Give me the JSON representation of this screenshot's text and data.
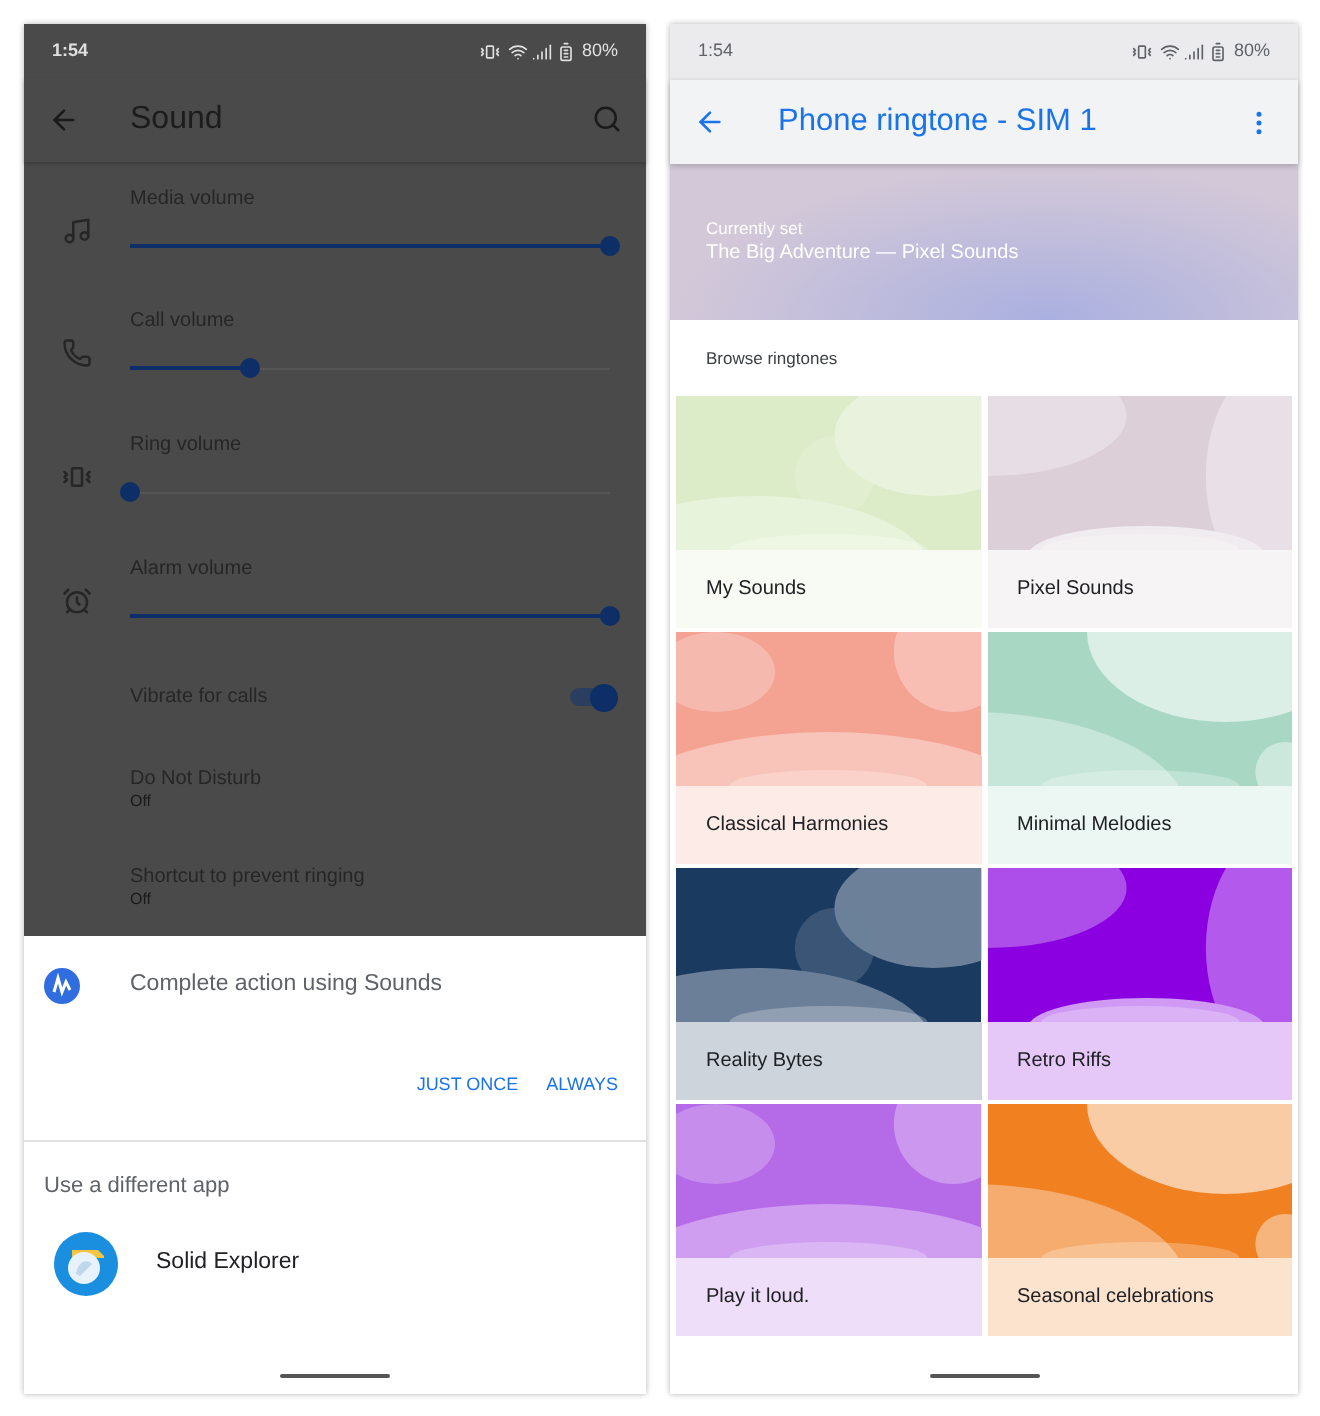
{
  "left_screen": {
    "status_bar": {
      "time": "1:54",
      "battery": "80%"
    },
    "toolbar": {
      "title": "Sound"
    },
    "sliders": [
      {
        "label": "Media volume",
        "level": 1
      },
      {
        "label": "Call volume",
        "level": 0.25
      },
      {
        "label": "Ring volume",
        "level": 0
      },
      {
        "label": "Alarm volume",
        "level": 1
      }
    ],
    "settings": [
      {
        "kind": "toggle",
        "label": "Vibrate for calls",
        "on": true
      },
      {
        "kind": "summary",
        "label": "Do Not Disturb",
        "value": "Off"
      },
      {
        "kind": "summary",
        "label": "Shortcut to prevent ringing",
        "value": "Off"
      }
    ],
    "dialog": {
      "title": "Complete action using Sounds",
      "buttons": [
        "JUST ONCE",
        "ALWAYS"
      ],
      "section": "Use a different app",
      "apps": [
        {
          "name": "Solid Explorer"
        }
      ]
    }
  },
  "right_screen": {
    "status_bar": {
      "time": "1:54",
      "battery": "80%"
    },
    "toolbar": {
      "title": "Phone ringtone - SIM 1"
    },
    "banner": {
      "label": "Currently set",
      "value": "The Big Adventure — Pixel Sounds"
    },
    "section": "Browse ringtones",
    "tiles": [
      {
        "label": "My Sounds",
        "color": "#dcecc8"
      },
      {
        "label": "Pixel Sounds",
        "color": "#dccfd8"
      },
      {
        "label": "Classical Harmonies",
        "color": "#f4a393"
      },
      {
        "label": "Minimal Melodies",
        "color": "#a8d8c4"
      },
      {
        "label": "Reality Bytes",
        "color": "#1b3a60"
      },
      {
        "label": "Retro Riffs",
        "color": "#8a00e0"
      },
      {
        "label": "Play it loud.",
        "color": "#b56ae8"
      },
      {
        "label": "Seasonal celebrations",
        "color": "#f08020"
      }
    ]
  }
}
